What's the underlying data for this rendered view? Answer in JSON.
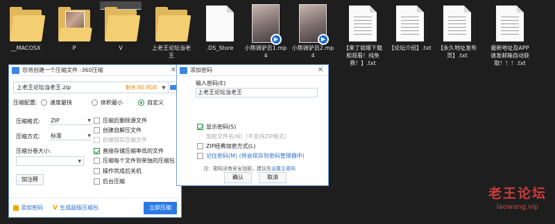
{
  "files": [
    {
      "name": "__MACOSX",
      "type": "folder"
    },
    {
      "name": "P",
      "type": "folder-photo"
    },
    {
      "name": "V",
      "type": "folder",
      "selected": true
    },
    {
      "name": "上老王论坛当老王",
      "type": "folder"
    },
    {
      "name": ".DS_Store",
      "type": "doc"
    },
    {
      "name": "小熊骑驴员1.mp4",
      "type": "video"
    },
    {
      "name": "小熊骑驴员2.mp4",
      "type": "video"
    },
    {
      "name": "【来了就顺下载和观看！纯免费！】.txt",
      "type": "doc"
    },
    {
      "name": "【论坛介绍】.txt",
      "type": "doc"
    },
    {
      "name": "【永久地址发布页】.txt",
      "type": "doc"
    },
    {
      "name": "最新地址及APP请发邮箱自动获取！！！.txt",
      "type": "doc"
    }
  ],
  "compress_dialog": {
    "title": "您将创建一个压缩文件 -360压缩",
    "close": "✕",
    "path": "上老王论坛当老王.zip",
    "free_space": "剩余:80.8GB",
    "config_label": "压缩配置:",
    "config_options": [
      "速度最快",
      "体积最小",
      "自定义"
    ],
    "format_label": "压缩格式:",
    "format_value": "ZIP",
    "method_label": "压缩方式:",
    "method_value": "标准",
    "split_label": "压缩分卷大小:",
    "note_button": "加注释",
    "checks": [
      {
        "label": "压缩后删除源文件",
        "state": "off"
      },
      {
        "label": "创建自解压文件",
        "state": "off"
      },
      {
        "label": "创建固实压缩文件",
        "state": "disabled"
      },
      {
        "label": "直接存储压缩率低的文件",
        "state": "on"
      },
      {
        "label": "压缩每个文件到单独的压缩包",
        "state": "off"
      },
      {
        "label": "操作完成后关机",
        "state": "off"
      },
      {
        "label": "后台压缩",
        "state": "off"
      }
    ],
    "add_password": "添加密码",
    "super_compress": "生成超级压缩包",
    "start": "立即压缩"
  },
  "password_dialog": {
    "title": "添加密码",
    "close": "✕",
    "input_label": "输入密码(E)",
    "input_value": "上老王论坛当老王",
    "checks": [
      {
        "label": "显示密码(S)",
        "state": "on"
      },
      {
        "label": "加密文件名(N)（不支持ZIP格式）",
        "state": "disabled"
      },
      {
        "label": "ZIP经典加密方式(L)",
        "state": "off"
      },
      {
        "label": "记住密码(M) (将会保存到密码管理器中)",
        "state": "off"
      }
    ],
    "note_prefix": "注：密码没有安全加密，建议先",
    "note_link": "设置主密码",
    "ok": "确认",
    "cancel": "取消"
  },
  "watermark": {
    "title": "老王论坛",
    "url": "laowang.vip"
  }
}
